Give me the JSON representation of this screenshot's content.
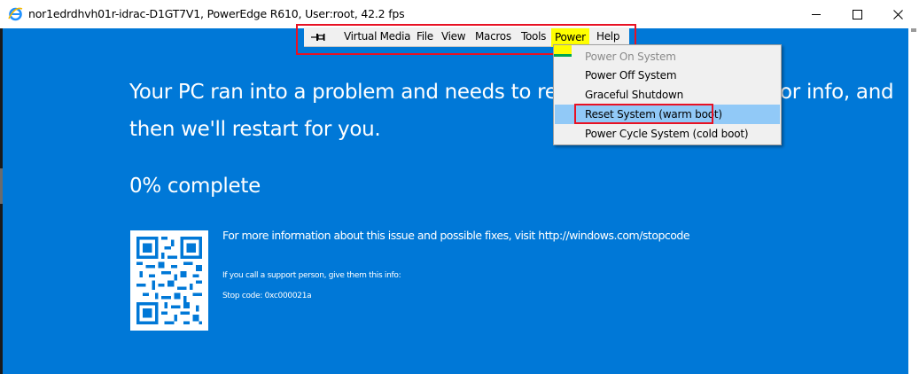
{
  "window": {
    "title": "nor1edrdhvh01r-idrac-D1GT7V1, PowerEdge R610, User:root, 42.2 fps",
    "icon": "ie-icon",
    "buttons": [
      "minimize-icon",
      "maximize-icon",
      "close-icon"
    ]
  },
  "toolbar": {
    "pin_icon": "pin-icon",
    "items": [
      "Virtual Media",
      "File",
      "View",
      "Macros",
      "Tools",
      "Power",
      "Help"
    ],
    "highlighted_item": "Power",
    "highlight_color": "#ffff00"
  },
  "power_menu": {
    "items": [
      {
        "label": "Power On System",
        "enabled": false
      },
      {
        "label": "Power Off System",
        "enabled": true
      },
      {
        "label": "Graceful Shutdown",
        "enabled": true
      },
      {
        "label": "Reset System (warm boot)",
        "enabled": true,
        "hovered": true
      },
      {
        "label": "Power Cycle System (cold boot)",
        "enabled": true
      }
    ]
  },
  "bsod": {
    "line1": "Your PC ran into a problem and needs to restart. W",
    "line1_tail": "or info, and",
    "line2": "then we'll restart for you.",
    "progress": "0% complete",
    "more_info": "For more information about this issue and possible fixes, visit http://windows.com/stopcode",
    "support": "If you call a support person, give them this info:",
    "stop_code": "Stop code: 0xc000021a",
    "background_color": "#0078d7"
  },
  "annotation_color": "#e81123"
}
